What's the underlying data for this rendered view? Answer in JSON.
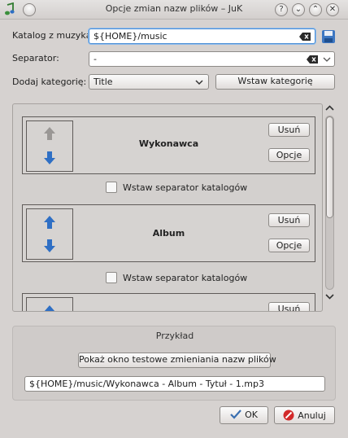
{
  "window": {
    "title": "Opcje zmian nazw plików – JuK"
  },
  "titlebar_buttons": [
    {
      "icon": "help-icon",
      "glyph": "?"
    },
    {
      "icon": "minimize-icon",
      "glyph": "⌄"
    },
    {
      "icon": "maximize-icon",
      "glyph": "⌃"
    },
    {
      "icon": "close-icon",
      "glyph": "✕"
    }
  ],
  "form": {
    "music_folder_label": "Katalog z muzyką:",
    "music_folder_value": "${HOME}/music",
    "separator_label": "Separator:",
    "separator_value": "-",
    "add_category_label": "Dodaj kategorię:",
    "add_category_selected": "Title",
    "insert_category_button": "Wstaw kategorię"
  },
  "categories": [
    {
      "name": "Wykonawca",
      "remove_button": "Usuń",
      "options_button": "Opcje",
      "separator_checkbox": "Wstaw separator katalogów",
      "separator_checked": false
    },
    {
      "name": "Album",
      "remove_button": "Usuń",
      "options_button": "Opcje",
      "separator_checkbox": "Wstaw separator katalogów",
      "separator_checked": false
    },
    {
      "name": "",
      "remove_button": "Usuń"
    }
  ],
  "example": {
    "group_title": "Przykład",
    "show_test_window_button": "Pokaż okno testowe zmieniania nazw plików",
    "example_path": "${HOME}/music/Wykonawca - Album - Tytuł - 1.mp3"
  },
  "dialog_buttons": {
    "ok": "OK",
    "cancel": "Anuluj"
  },
  "colors": {
    "focus_border": "#4c8fd6",
    "arrow_blue": "#2f6fc4",
    "cancel_red": "#d22a2a",
    "ok_check": "#3a6fb0"
  }
}
